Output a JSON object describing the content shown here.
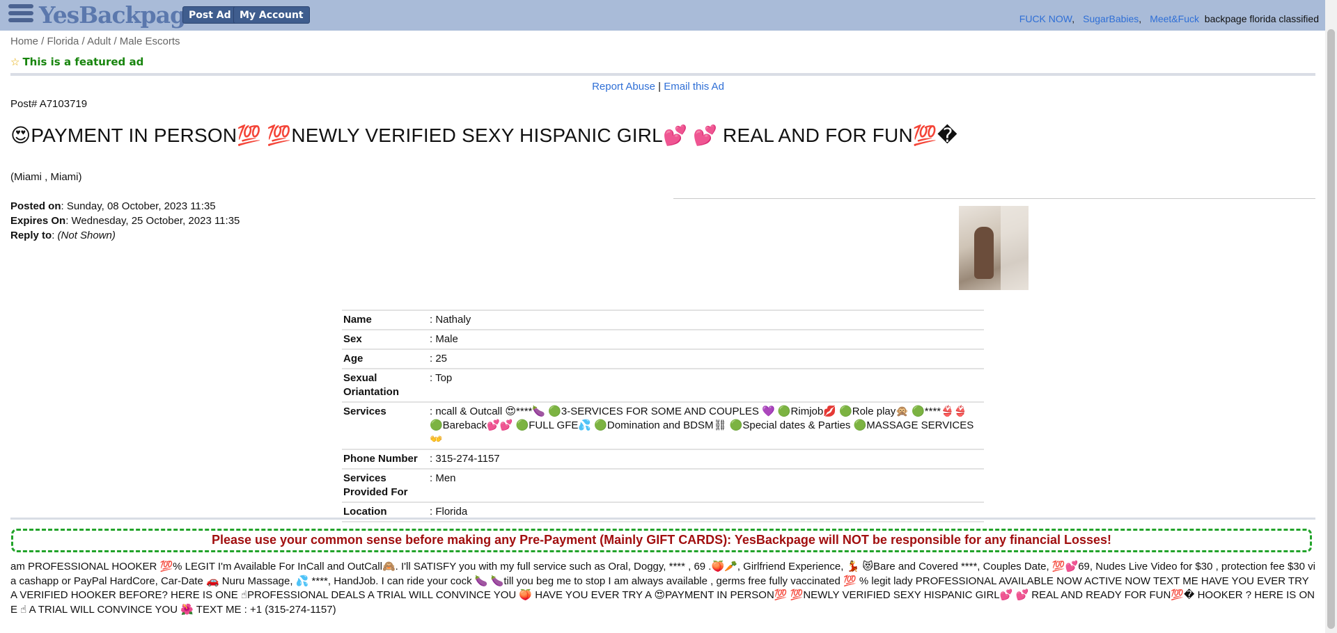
{
  "header": {
    "logo": "YesBackpage",
    "post_ad": "Post Ad",
    "my_account": "My Account",
    "links": [
      "FUCK NOW",
      "SugarBabies",
      "Meet&Fuck"
    ],
    "tagline": "backpage florida classified"
  },
  "breadcrumb": [
    "Home",
    "Florida",
    "Adult",
    "Male Escorts"
  ],
  "featured": "This is a featured ad",
  "actions": {
    "report": "Report Abuse",
    "email": "Email this Ad"
  },
  "post_number": "Post# A7103719",
  "title": "😍PAYMENT IN PERSON💯 💯NEWLY VERIFIED SEXY HISPANIC GIRL💕 💕 REAL AND FOR FUN💯�",
  "location_line": "(Miami , Miami)",
  "meta": {
    "posted_label": "Posted on",
    "posted_value": ": Sunday, 08 October, 2023  11:35",
    "expires_label": "Expires On",
    "expires_value": ": Wednesday, 25 October, 2023  11:35",
    "reply_label": "Reply to",
    "reply_colon": ": ",
    "reply_value": "(Not Shown)"
  },
  "details": [
    {
      "key": "Name",
      "value": ": Nathaly"
    },
    {
      "key": "Sex",
      "value": ": Male"
    },
    {
      "key": "Age",
      "value": ": 25"
    },
    {
      "key": "Sexual Oriantation",
      "value": ": Top"
    },
    {
      "key": "Services",
      "value": ": ncall & Outcall 😍****🍆 🟢3-SERVICES FOR SOME AND COUPLES 💜 🟢Rimjob💋 🟢Role play🙊 🟢****👙👙 🟢Bareback💕💕 🟢FULL GFE💦 🟢Domination and BDSM⛓ 🟢Special dates & Parties 🟢MASSAGE SERVICES👐"
    },
    {
      "key": "Phone Number",
      "value": ": 315-274-1157"
    },
    {
      "key": "Services Provided For",
      "value": ": Men"
    },
    {
      "key": "Location",
      "value": ": Florida"
    }
  ],
  "warning": "Please use your common sense before making any Pre-Payment (Mainly GIFT CARDS): YesBackpage will NOT be responsible for any financial Losses!",
  "description": "am PROFESSIONAL HOOKER 💯% LEGIT I'm Available For InCall and OutCall🙈. I'll SATISFY you with my full service such as Oral, Doggy, **** , 69 .🍑🥕, Girlfriend Experience, 💃 😻Bare and Covered ****, Couples Date, 💯💕69, Nudes Live Video for $30 , protection fee $30 via cashapp or PayPal HardCore, Car-Date 🚗 Nuru Massage, 💦 ****, HandJob. I can ride your cock 🍆 🍆till you beg me to stop I am always available , germs free fully vaccinated 💯 % legit lady PROFESSIONAL AVAILABLE NOW ACTIVE NOW TEXT ME HAVE YOU EVER TRY A VERIFIED HOOKER BEFORE? HERE IS ONE ☝PROFESSIONAL DEALS A TRIAL WILL CONVINCE YOU 🍑 HAVE YOU EVER TRY A 😍PAYMENT IN PERSON💯 💯NEWLY VERIFIED SEXY HISPANIC GIRL💕 💕 REAL AND READY FOR FUN💯� HOOKER ? HERE IS ONE ☝ A TRIAL WILL CONVINCE YOU 🌺 TEXT ME : +1 (315-274-1157)"
}
